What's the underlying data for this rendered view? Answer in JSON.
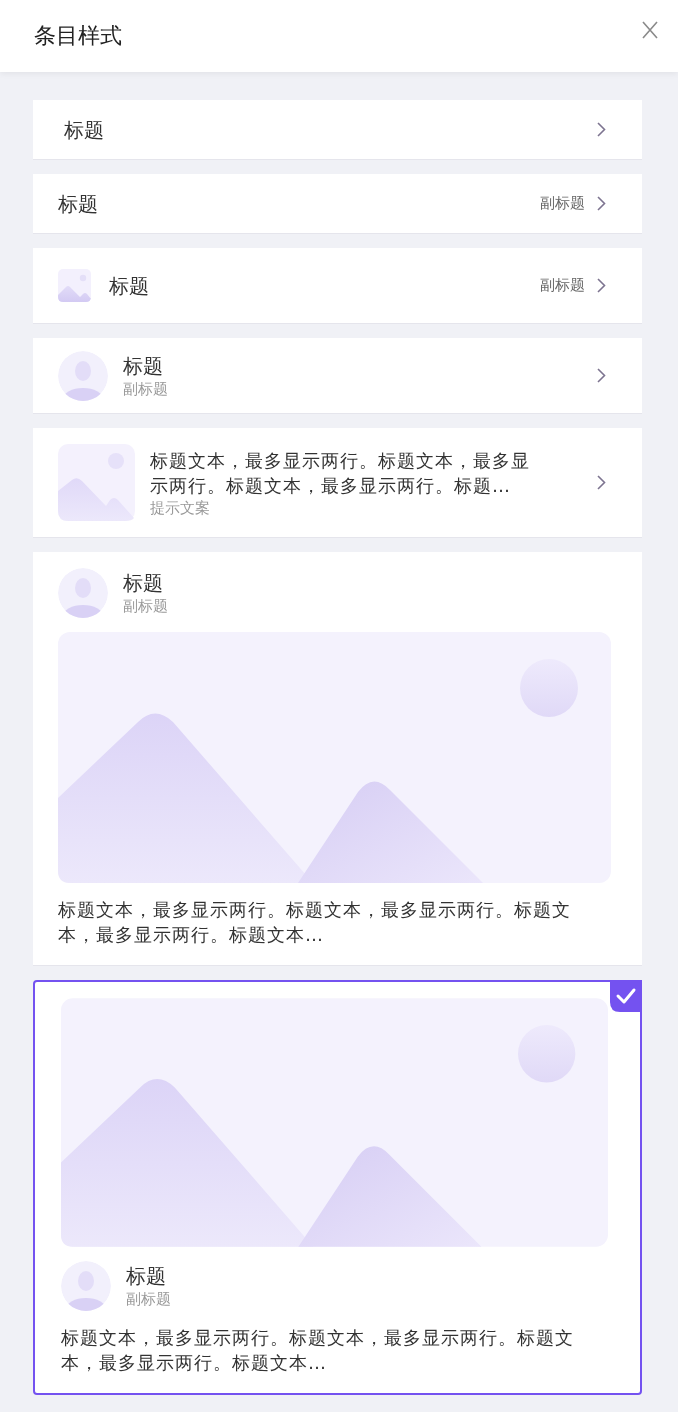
{
  "header": {
    "title": "条目样式"
  },
  "items": [
    {
      "kind": "plain",
      "title": "标题",
      "selected": false
    },
    {
      "kind": "trailing-subtitle",
      "title": "标题",
      "subtitle": "副标题",
      "selected": false
    },
    {
      "kind": "thumb",
      "title": "标题",
      "subtitle": "副标题",
      "selected": false
    },
    {
      "kind": "avatar",
      "title": "标题",
      "subtitle": "副标题",
      "selected": false
    },
    {
      "kind": "media",
      "text": "标题文本，最多显示两行。标题文本，最多显示两行。标题文本，最多显示两行。标题…",
      "hint": "提示文案",
      "selected": false
    },
    {
      "kind": "post",
      "title": "标题",
      "subtitle": "副标题",
      "text": "标题文本，最多显示两行。标题文本，最多显示两行。标题文本，最多显示两行。标题文本…",
      "selected": false
    },
    {
      "kind": "image-post",
      "title": "标题",
      "subtitle": "副标题",
      "text": "标题文本，最多显示两行。标题文本，最多显示两行。标题文本，最多显示两行。标题文本…",
      "selected": true
    }
  ]
}
